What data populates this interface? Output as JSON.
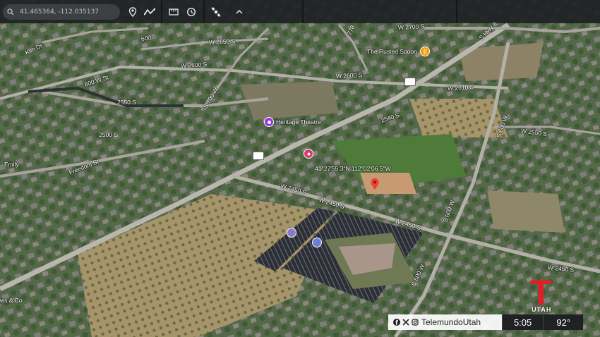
{
  "toolbar": {
    "search_value": "41.465364, -112.035137",
    "icons": [
      "search-icon",
      "pin-icon",
      "path-icon",
      "ruler-icon",
      "history-icon",
      "satellite-icon",
      "chevron-up-icon"
    ]
  },
  "roads": [
    {
      "name": "W 2650 S",
      "id": "w2650s"
    },
    {
      "name": "W 2600 S",
      "id": "w2600s-a"
    },
    {
      "name": "W 2600 S",
      "id": "w2600s-b"
    },
    {
      "name": "W 2700 S",
      "id": "w2700s"
    },
    {
      "name": "S Hwy 3",
      "id": "hwy3"
    },
    {
      "name": "600",
      "id": "r600"
    },
    {
      "name": "Kim Dr",
      "id": "kimdr"
    },
    {
      "name": "600 W St",
      "id": "600wst"
    },
    {
      "name": "2550 S",
      "id": "2550s-a"
    },
    {
      "name": "S 700 W",
      "id": "s700w"
    },
    {
      "name": "2500 S",
      "id": "2500s"
    },
    {
      "name": "Freedom St",
      "id": "freedom"
    },
    {
      "name": "Emily",
      "id": "emily"
    },
    {
      "name": "W 2610 S",
      "id": "w2610s"
    },
    {
      "name": "2540 S",
      "id": "2540s"
    },
    {
      "name": "S 600 W",
      "id": "s600w-a"
    },
    {
      "name": "W 2550 S",
      "id": "w2550s"
    },
    {
      "name": "W 2450 S",
      "id": "w2450s-a"
    },
    {
      "name": "W 2450 S",
      "id": "w2450s-b"
    },
    {
      "name": "W 2450 S",
      "id": "w2450s-c"
    },
    {
      "name": "W 2450 S",
      "id": "w2450s-d"
    },
    {
      "name": "S 600 W",
      "id": "s600w-b"
    },
    {
      "name": "S 600 W",
      "id": "s600w-c"
    },
    {
      "name": "778",
      "id": "r778"
    },
    {
      "name": "ws & Co",
      "id": "wsco"
    }
  ],
  "pois": {
    "rusted_spoon": "The Rusted Spoon",
    "heritage_theatre": "Heritage Theatre"
  },
  "coordinate_label": "41°27'55.3\"N 112°02'06.5\"W",
  "colors": {
    "toolbar": "#202124",
    "poi_purple": "#9334e6",
    "poi_orange": "#f29900",
    "pin_red": "#ea4335",
    "brand_red": "#e21d28"
  },
  "broadcast": {
    "logo_letter": "T",
    "logo_region": "UTAH",
    "social_handle": "TelemundoUtah",
    "time": "5:05",
    "temperature": "92°"
  }
}
